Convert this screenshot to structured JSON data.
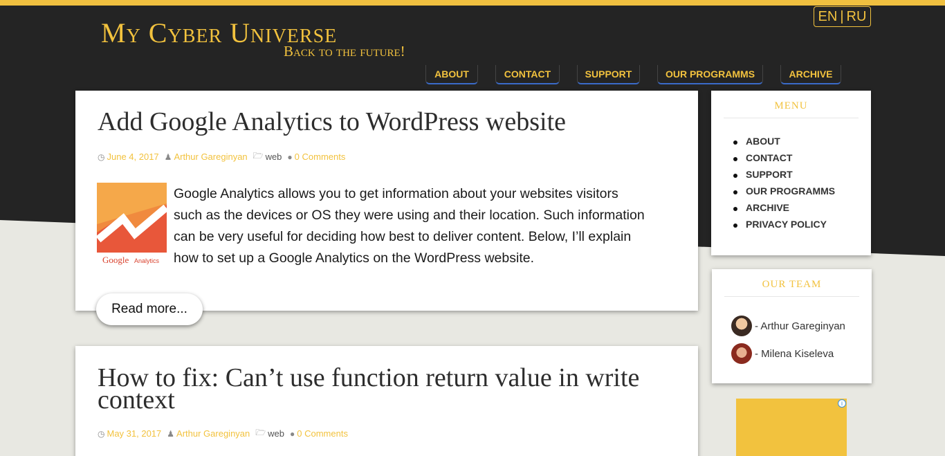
{
  "site": {
    "title": "My Cyber Universe",
    "tagline": "Back to the future!"
  },
  "lang": {
    "en": "EN",
    "sep": "|",
    "ru": "RU"
  },
  "nav": [
    "ABOUT",
    "CONTACT",
    "SUPPORT",
    "OUR PROGRAMMS",
    "ARCHIVE"
  ],
  "posts": [
    {
      "title": "Add Google Analytics to WordPress website",
      "date": "June 4, 2017",
      "author": "Arthur Gareginyan",
      "category": "web",
      "comments": "0 Comments",
      "excerpt_lines": [
        "Google Analytics allows you to get information about your websites visitors",
        "such as the devices or OS they were using and their location. Such information",
        "can be very useful for deciding how best to deliver content. Below, I’ll explain",
        "how to set up a Google Analytics on the WordPress website."
      ],
      "thumb_label_google": "Google",
      "thumb_label_analytics": "Analytics",
      "read_more": "Read more..."
    },
    {
      "title_line1": "How to fix: Can’t use function return value in write",
      "title_line2": "context",
      "date": "May 31, 2017",
      "author": "Arthur Gareginyan",
      "category": "web",
      "comments": "0 Comments"
    }
  ],
  "sidebar": {
    "menu_title": "MENU",
    "menu_items": [
      "ABOUT",
      "CONTACT",
      "SUPPORT",
      "OUR PROGRAMMS",
      "ARCHIVE",
      "PRIVACY POLICY"
    ],
    "team_title": "OUR TEAM",
    "team": [
      "- Arthur Gareginyan",
      "- Milena Kiseleva"
    ],
    "ad_info": "i"
  },
  "colors": {
    "accent": "#f2c23e",
    "dark": "#242424",
    "light_bg": "#e8e8e2",
    "nav_underline": "#3a6bc9"
  }
}
